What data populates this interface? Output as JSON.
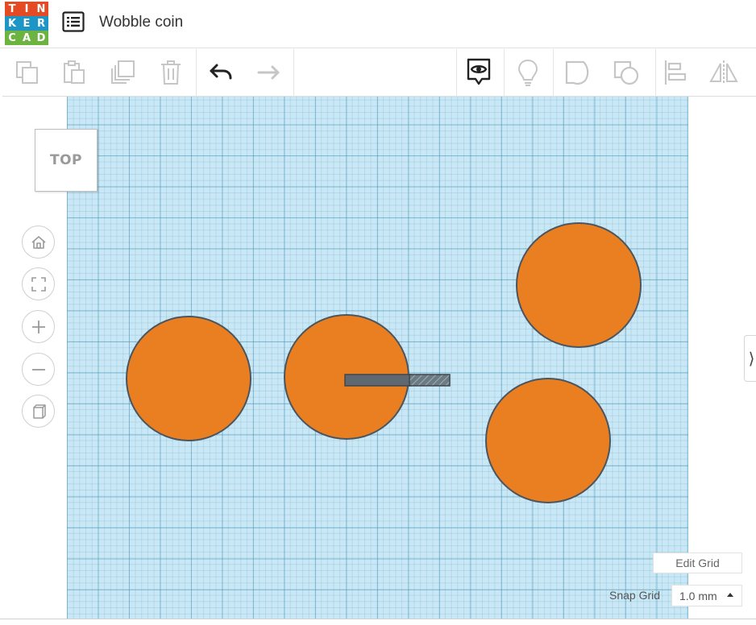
{
  "header": {
    "logo_letters": [
      "T",
      "I",
      "N",
      "K",
      "E",
      "R",
      "C",
      "A",
      "D"
    ],
    "logo_colors": [
      "#E44B24",
      "#E44B24",
      "#E44B24",
      "#1C96C6",
      "#1C96C6",
      "#1C96C6",
      "#6CB33F",
      "#6CB33F",
      "#6CB33F"
    ],
    "title": "Wobble coin"
  },
  "toolbar": {
    "buttons": [
      {
        "name": "copy-icon",
        "enabled": false
      },
      {
        "name": "paste-icon",
        "enabled": false
      },
      {
        "name": "duplicate-icon",
        "enabled": false
      },
      {
        "name": "delete-icon",
        "enabled": false
      },
      {
        "name": "undo-icon",
        "enabled": true
      },
      {
        "name": "redo-icon",
        "enabled": false
      },
      {
        "name": "show-all-icon",
        "enabled": true
      },
      {
        "name": "notes-lightbulb-icon",
        "enabled": false
      },
      {
        "name": "group-icon",
        "enabled": false
      },
      {
        "name": "ungroup-icon",
        "enabled": false
      },
      {
        "name": "align-icon",
        "enabled": false
      },
      {
        "name": "mirror-icon",
        "enabled": false
      }
    ]
  },
  "viewport": {
    "view_cube_label": "TOP",
    "nav_buttons": [
      "home-icon",
      "fit-view-icon",
      "zoom-in-icon",
      "zoom-out-icon",
      "perspective-icon"
    ],
    "shape_color": "#EA7F22",
    "shape_outline": "#4a5560",
    "selected_bar_color": "#5f6870",
    "grid_color": "#c9e7f4"
  },
  "controls": {
    "edit_grid_label": "Edit Grid",
    "snap_grid_label": "Snap Grid",
    "snap_grid_value": "1.0 mm"
  }
}
